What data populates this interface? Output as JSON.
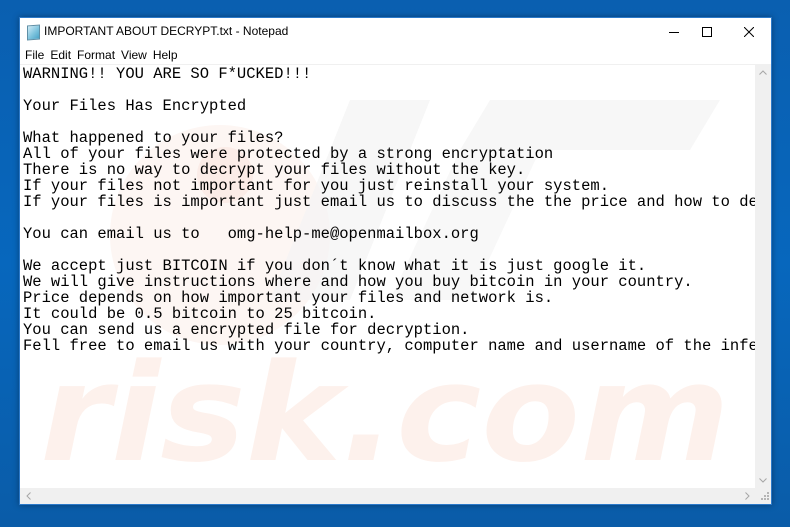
{
  "window": {
    "title": "IMPORTANT ABOUT DECRYPT.txt - Notepad",
    "app_icon": "notepad-icon",
    "controls": {
      "minimize": "minimize-icon",
      "maximize": "maximize-icon",
      "close": "close-icon"
    }
  },
  "menu": {
    "items": [
      {
        "label": "File"
      },
      {
        "label": "Edit"
      },
      {
        "label": "Format"
      },
      {
        "label": "View"
      },
      {
        "label": "Help"
      }
    ]
  },
  "document": {
    "lines": [
      "WARNING!! YOU ARE SO F*UCKED!!!",
      "",
      "Your Files Has Encrypted",
      "",
      "What happened to your files?",
      "All of your files were protected by a strong encryptation",
      "There is no way to decrypt your files without the key.",
      "If your files not important for you just reinstall your system.",
      "If your files is important just email us to discuss the the price and how to decrypt your files.",
      "",
      "You can email us to   omg-help-me@openmailbox.org",
      "",
      "We accept just BITCOIN if you don´t know what it is just google it.",
      "We will give instructions where and how you buy bitcoin in your country.",
      "Price depends on how important your files and network is.",
      "It could be 0.5 bitcoin to 25 bitcoin.",
      "You can send us a encrypted file for decryption.",
      "Fell free to email us with your country, computer name and username of the infected system."
    ]
  },
  "watermark": {
    "text": "risk.com",
    "color": "#fdf1ec"
  },
  "scrollbars": {
    "up": "chevron-up-icon",
    "down": "chevron-down-icon",
    "left": "chevron-left-icon",
    "right": "chevron-right-icon",
    "grip": "resize-grip-icon"
  },
  "colors": {
    "desktop": "#0063b1",
    "window_border": "#2b79c9",
    "scrollbar": "#f0f0f0"
  }
}
